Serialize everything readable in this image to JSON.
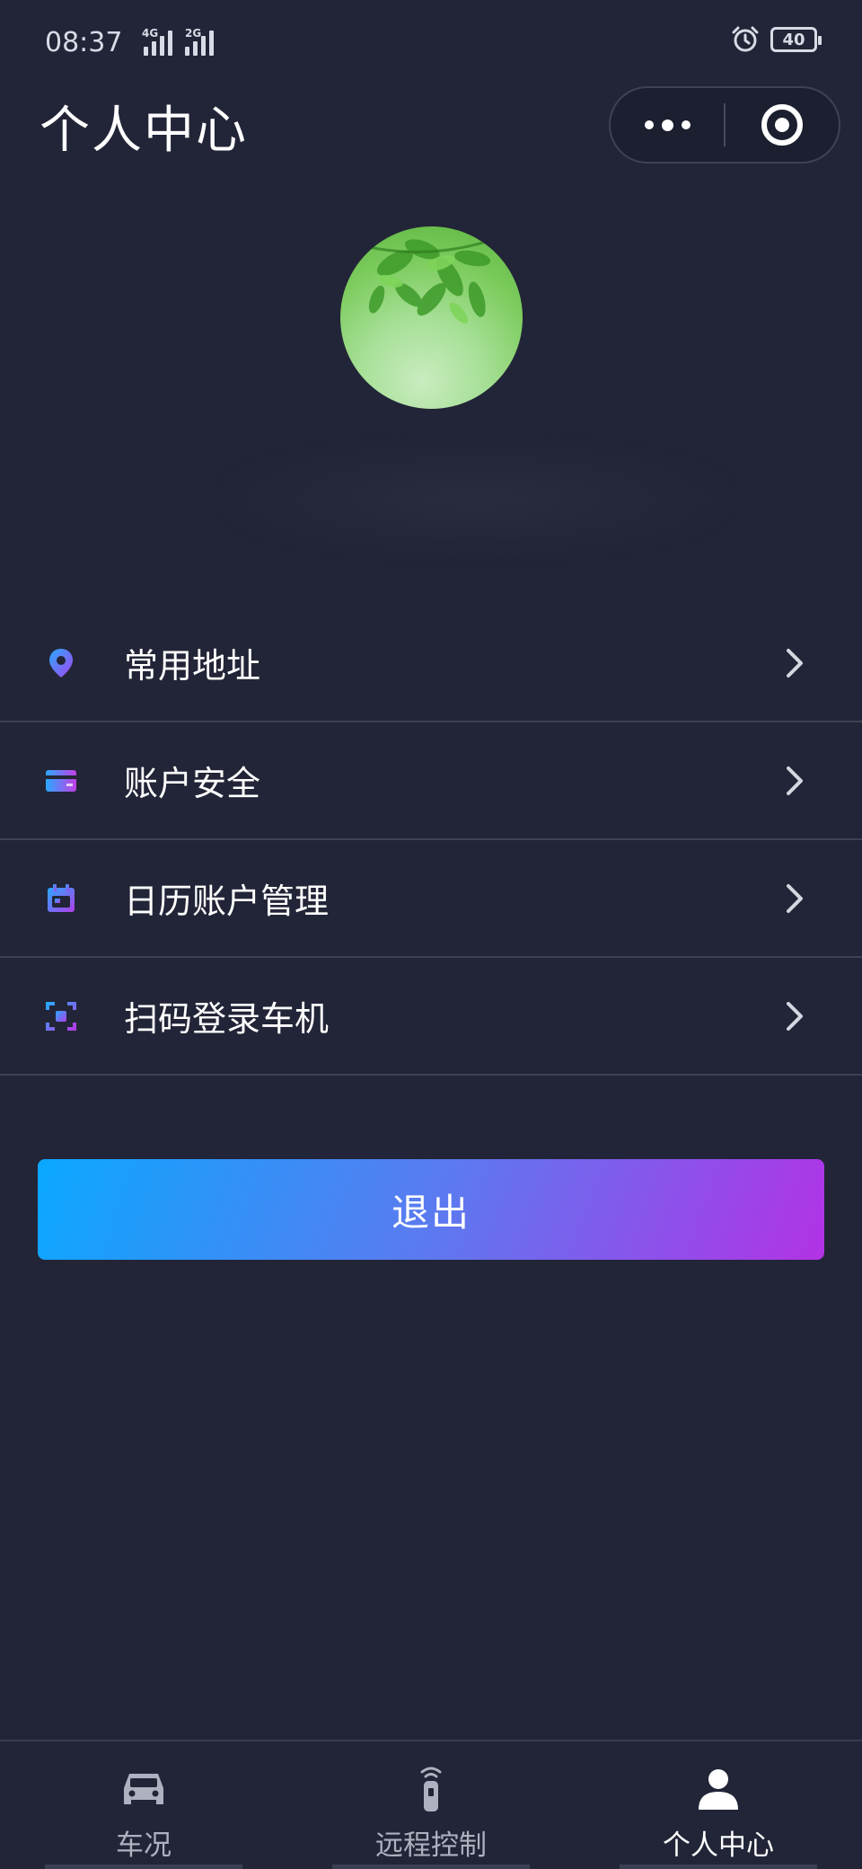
{
  "status": {
    "time": "08:37",
    "signal1_tag": "4G",
    "signal2_tag": "2G",
    "battery": "40"
  },
  "header": {
    "title": "个人中心"
  },
  "menu": {
    "items": [
      {
        "label": "常用地址",
        "icon": "location-pin-icon"
      },
      {
        "label": "账户安全",
        "icon": "card-icon"
      },
      {
        "label": "日历账户管理",
        "icon": "calendar-icon"
      },
      {
        "label": "扫码登录车机",
        "icon": "scan-icon"
      }
    ]
  },
  "actions": {
    "logout_label": "退出"
  },
  "tabbar": {
    "tabs": [
      {
        "label": "车况",
        "icon": "car-icon"
      },
      {
        "label": "远程控制",
        "icon": "remote-key-icon"
      },
      {
        "label": "个人中心",
        "icon": "user-icon"
      }
    ],
    "active_index": 2
  },
  "colors": {
    "background": "#222537",
    "accent_gradient_start": "#0aa8ff",
    "accent_gradient_end": "#b232e6",
    "divider": "#3d4154"
  }
}
